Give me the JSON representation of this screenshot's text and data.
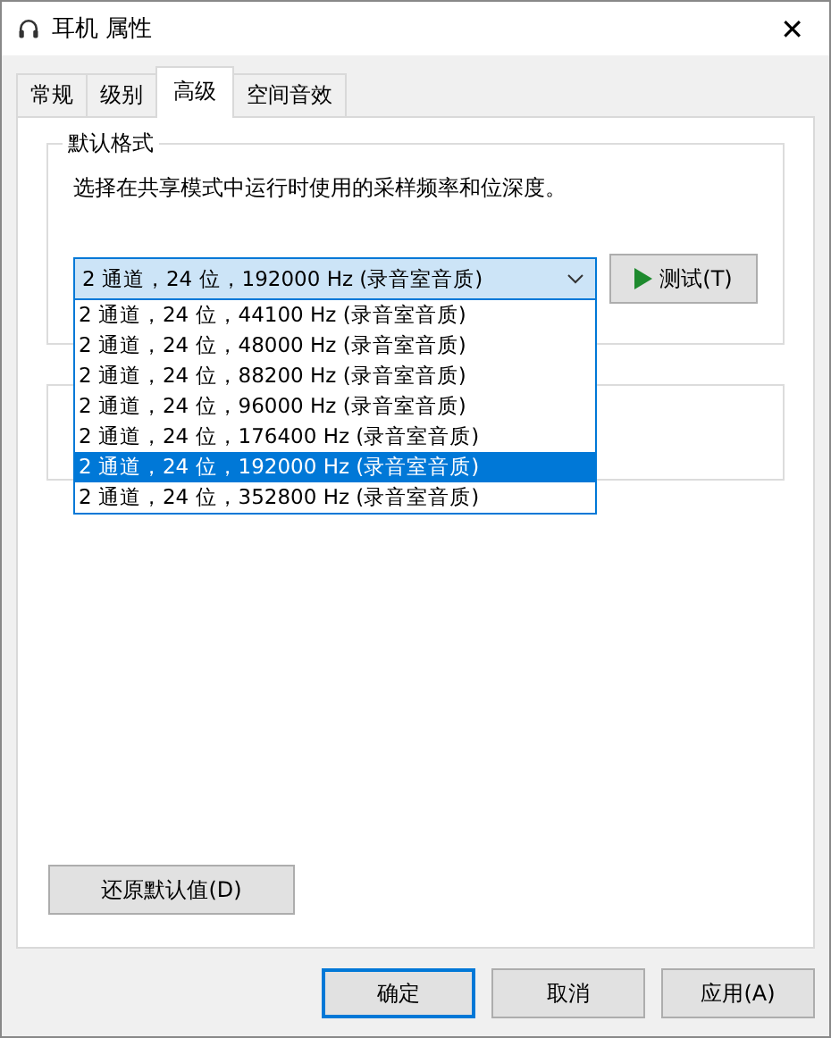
{
  "window": {
    "title": "耳机 属性",
    "close": "✕"
  },
  "tabs": [
    {
      "label": "常规",
      "selected": false
    },
    {
      "label": "级别",
      "selected": false
    },
    {
      "label": "高级",
      "selected": true
    },
    {
      "label": "空间音效",
      "selected": false
    }
  ],
  "default_format": {
    "title": "默认格式",
    "description": "选择在共享模式中运行时使用的采样频率和位深度。",
    "dropdown": {
      "value": "2 通道，24 位，192000 Hz (录音室音质)",
      "expanded": true,
      "options": [
        {
          "label": "2 通道，24 位，44100 Hz (录音室音质)",
          "selected": false
        },
        {
          "label": "2 通道，24 位，48000 Hz (录音室音质)",
          "selected": false
        },
        {
          "label": "2 通道，24 位，88200 Hz (录音室音质)",
          "selected": false
        },
        {
          "label": "2 通道，24 位，96000 Hz (录音室音质)",
          "selected": false
        },
        {
          "label": "2 通道，24 位，176400 Hz (录音室音质)",
          "selected": false
        },
        {
          "label": "2 通道，24 位，192000 Hz (录音室音质)",
          "selected": true
        },
        {
          "label": "2 通道，24 位，352800 Hz (录音室音质)",
          "selected": false
        }
      ]
    },
    "test_button": "测试(T)"
  },
  "restore_button": "还原默认值(D)",
  "buttons": [
    {
      "label": "确定",
      "default": true
    },
    {
      "label": "取消",
      "default": false
    },
    {
      "label": "应用(A)",
      "default": false
    }
  ]
}
